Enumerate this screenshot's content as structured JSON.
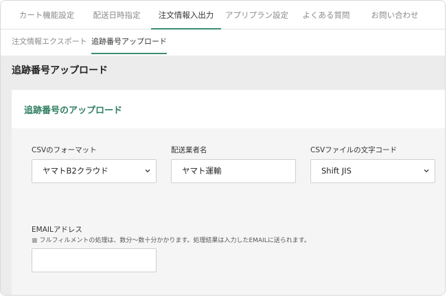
{
  "top_tabs": [
    {
      "label": "カート機能設定"
    },
    {
      "label": "配送日時指定"
    },
    {
      "label": "注文情報入出力"
    },
    {
      "label": "アプリプラン設定"
    },
    {
      "label": "よくある質問"
    },
    {
      "label": "お問い合わせ"
    }
  ],
  "sub_tabs": [
    {
      "label": "注文情報エクスポート"
    },
    {
      "label": "追跡番号アップロード"
    }
  ],
  "page": {
    "title": "追跡番号アップロード"
  },
  "card": {
    "title": "追跡番号のアップロード",
    "csv_format": {
      "label": "CSVのフォーマット",
      "value": "ヤマトB2クラウド"
    },
    "carrier": {
      "label": "配送業者名",
      "value": "ヤマト運輸"
    },
    "encoding": {
      "label": "CSVファイルの文字コード",
      "value": "Shift JIS"
    },
    "email": {
      "label": "EMAILアドレス",
      "help_mark": "■",
      "help": "フルフィルメントの処理は、数分〜数十分かかります。処理結果は入力したEMAILに送られます。",
      "value": ""
    }
  },
  "colors": {
    "accent": "#3a8f6e",
    "title_green": "#2e7d60",
    "gray_bg": "#ececec"
  },
  "icons": {
    "select": "chevron-down-icon"
  }
}
